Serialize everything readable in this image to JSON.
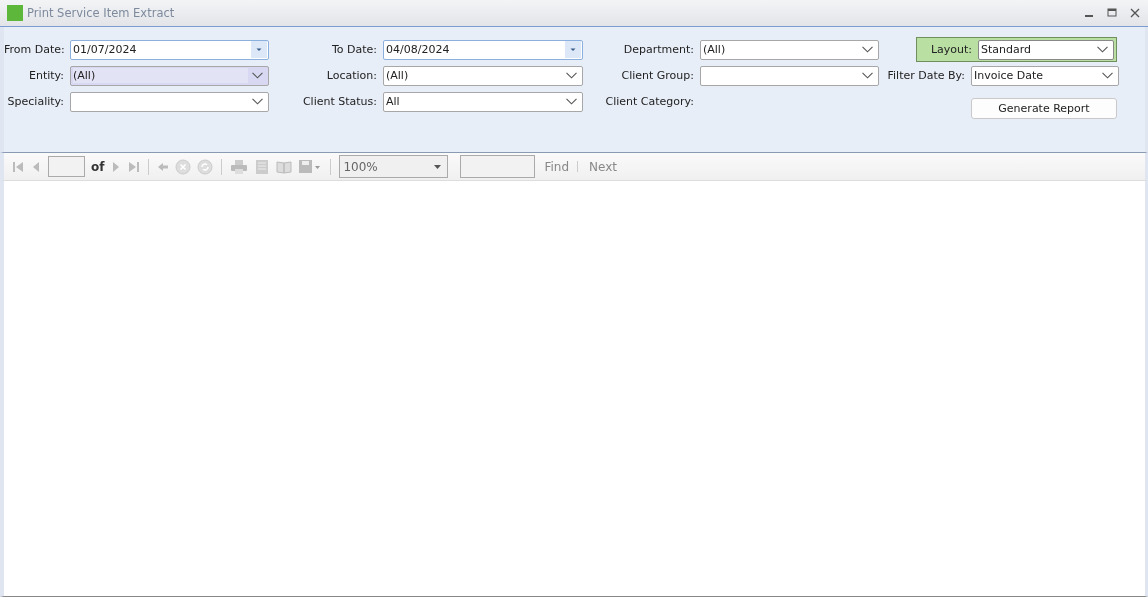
{
  "window": {
    "title": "Print Service Item Extract"
  },
  "filters": [
    {
      "kind": "date",
      "label": "From Date:",
      "value": "01/07/2024",
      "highlighted": false
    },
    {
      "kind": "date",
      "label": "To Date:",
      "value": "04/08/2024",
      "highlighted": false
    },
    {
      "kind": "combo",
      "label": "Department:",
      "value": "(All)",
      "highlighted": false
    },
    {
      "kind": "framed",
      "label": "Layout:",
      "value": "Standard",
      "highlighted": false
    },
    {
      "kind": "combo",
      "label": "Entity:",
      "value": "(All)",
      "highlighted": true
    },
    {
      "kind": "combo",
      "label": "Location:",
      "value": "(All)",
      "highlighted": false
    },
    {
      "kind": "combo",
      "label": "Client Group:",
      "highlighted": false
    },
    {
      "kind": "combo",
      "label": "Filter Date By:",
      "value": "Invoice Date",
      "highlighted": false
    },
    {
      "kind": "combo",
      "label": "Speciality:",
      "highlighted": false
    },
    {
      "kind": "combo",
      "label": "Client Status:",
      "value": "All",
      "highlighted": false
    },
    {
      "kind": "label",
      "label": "Client Category:",
      "highlighted": false
    },
    {
      "kind": "button",
      "label": "Generate Report",
      "highlighted": false
    }
  ],
  "toolbar": {
    "of": "of",
    "zoom": "100%",
    "find": "Find",
    "next": "Next"
  }
}
